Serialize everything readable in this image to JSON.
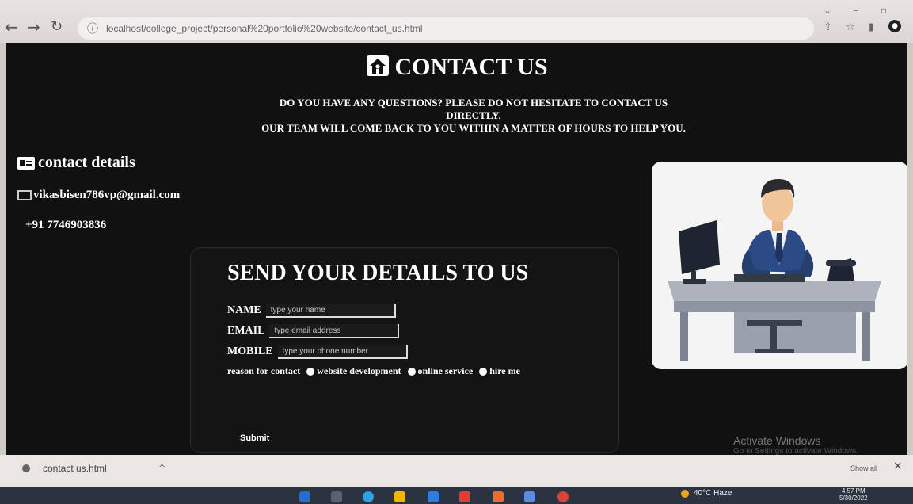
{
  "browser": {
    "url": "localhost/college_project/personal%20portfolio%20website/contact_us.html"
  },
  "page": {
    "title": "CONTACT US",
    "subtitle_line1": "DO YOU HAVE ANY QUESTIONS? PLEASE DO NOT HESITATE TO CONTACT US DIRECTLY.",
    "subtitle_line2": "OUR TEAM WILL COME BACK TO YOU WITHIN A MATTER OF HOURS TO HELP YOU.",
    "contact_heading": "contact details",
    "email": "vikasbisen786vp@gmail.com",
    "phone": "+91 7746903836"
  },
  "form": {
    "title": "SEND YOUR DETAILS TO US",
    "name_label": "NAME",
    "name_placeholder": "type your name",
    "email_label": "EMAIL",
    "email_placeholder": "type email address",
    "mobile_label": "MOBILE",
    "mobile_placeholder": "type your phone number",
    "reason_label": "reason for contact",
    "options": [
      "website development",
      "online service",
      "hire me"
    ],
    "submit_label": "Submit"
  },
  "watermark": {
    "title": "Activate Windows",
    "subtitle": "Go to Settings to activate Windows."
  },
  "downloads": {
    "file": "contact us.html",
    "show_all": "Show all"
  },
  "taskbar": {
    "weather": "40°C Haze",
    "time": "4:57 PM",
    "date": "5/30/2022"
  }
}
